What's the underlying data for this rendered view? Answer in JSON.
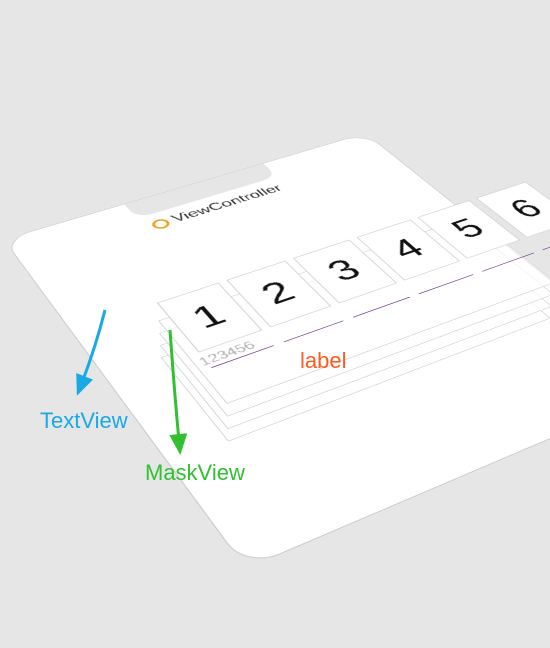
{
  "header": {
    "title": "ViewController"
  },
  "layers": {
    "textview_value": "123456",
    "digits": [
      "1",
      "2",
      "3",
      "4",
      "5",
      "6"
    ]
  },
  "callouts": {
    "textview": "TextView",
    "maskview": "MaskView",
    "label": "label"
  }
}
